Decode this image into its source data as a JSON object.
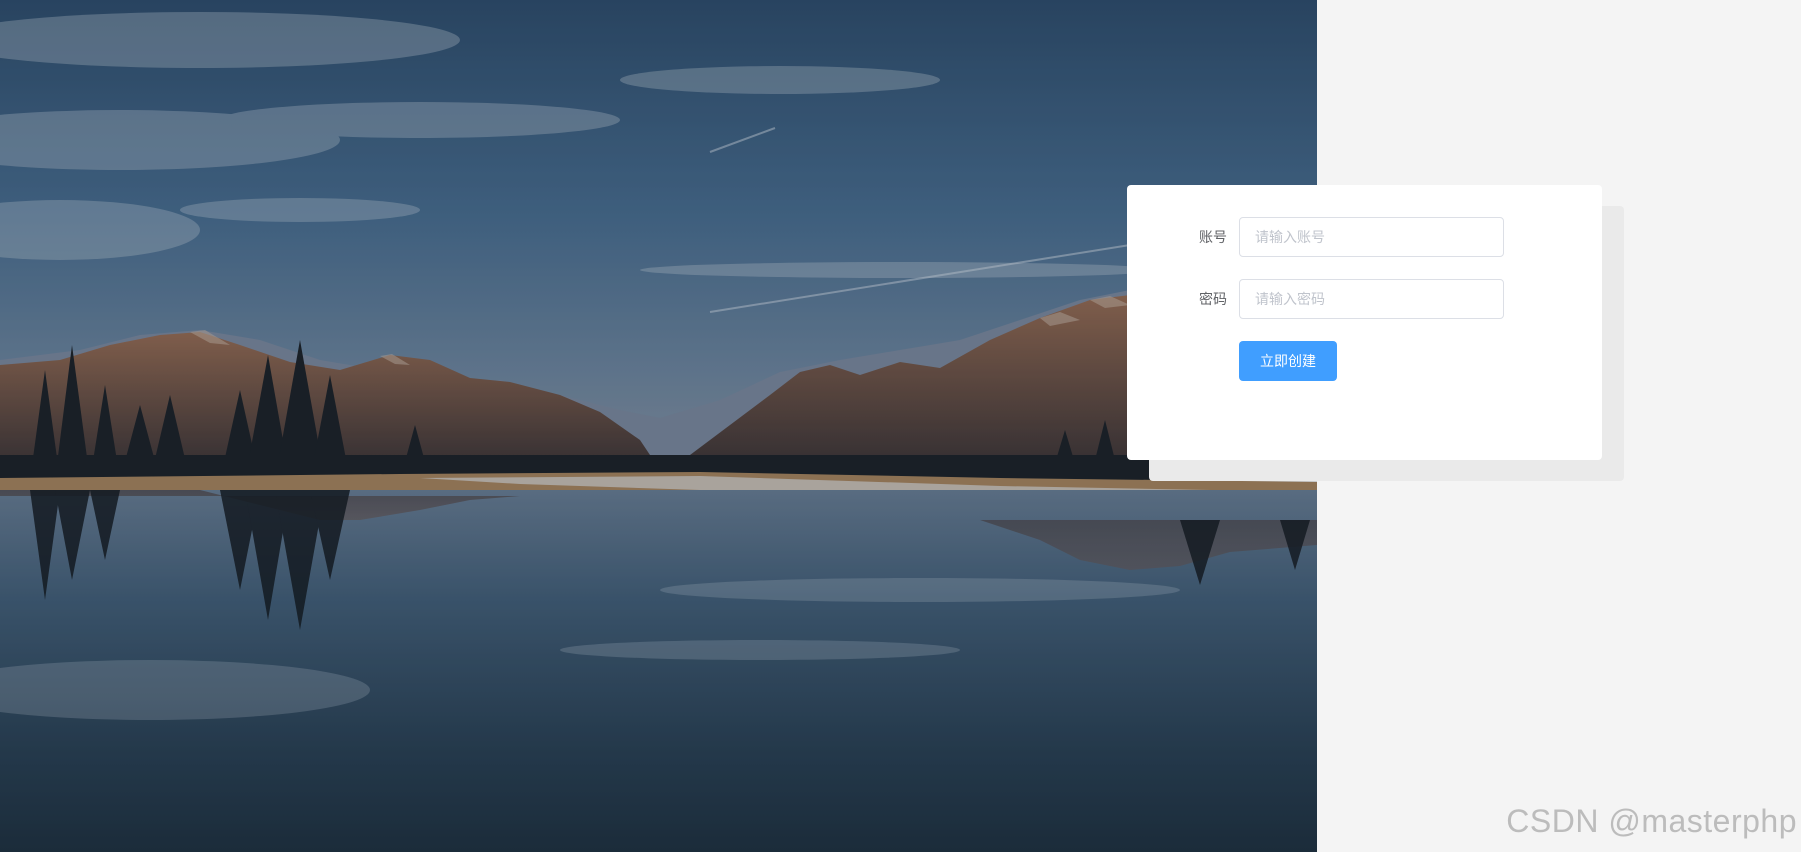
{
  "form": {
    "account_label": "账号",
    "account_placeholder": "请输入账号",
    "account_value": "",
    "password_label": "密码",
    "password_placeholder": "请输入密码",
    "password_value": "",
    "submit_label": "立即创建"
  },
  "watermark": {
    "text": "CSDN @masterphp"
  },
  "colors": {
    "primary": "#409eff",
    "label": "#606266",
    "placeholder": "#c0c4cc",
    "border": "#dcdfe6",
    "page_background": "#f4f4f4"
  }
}
